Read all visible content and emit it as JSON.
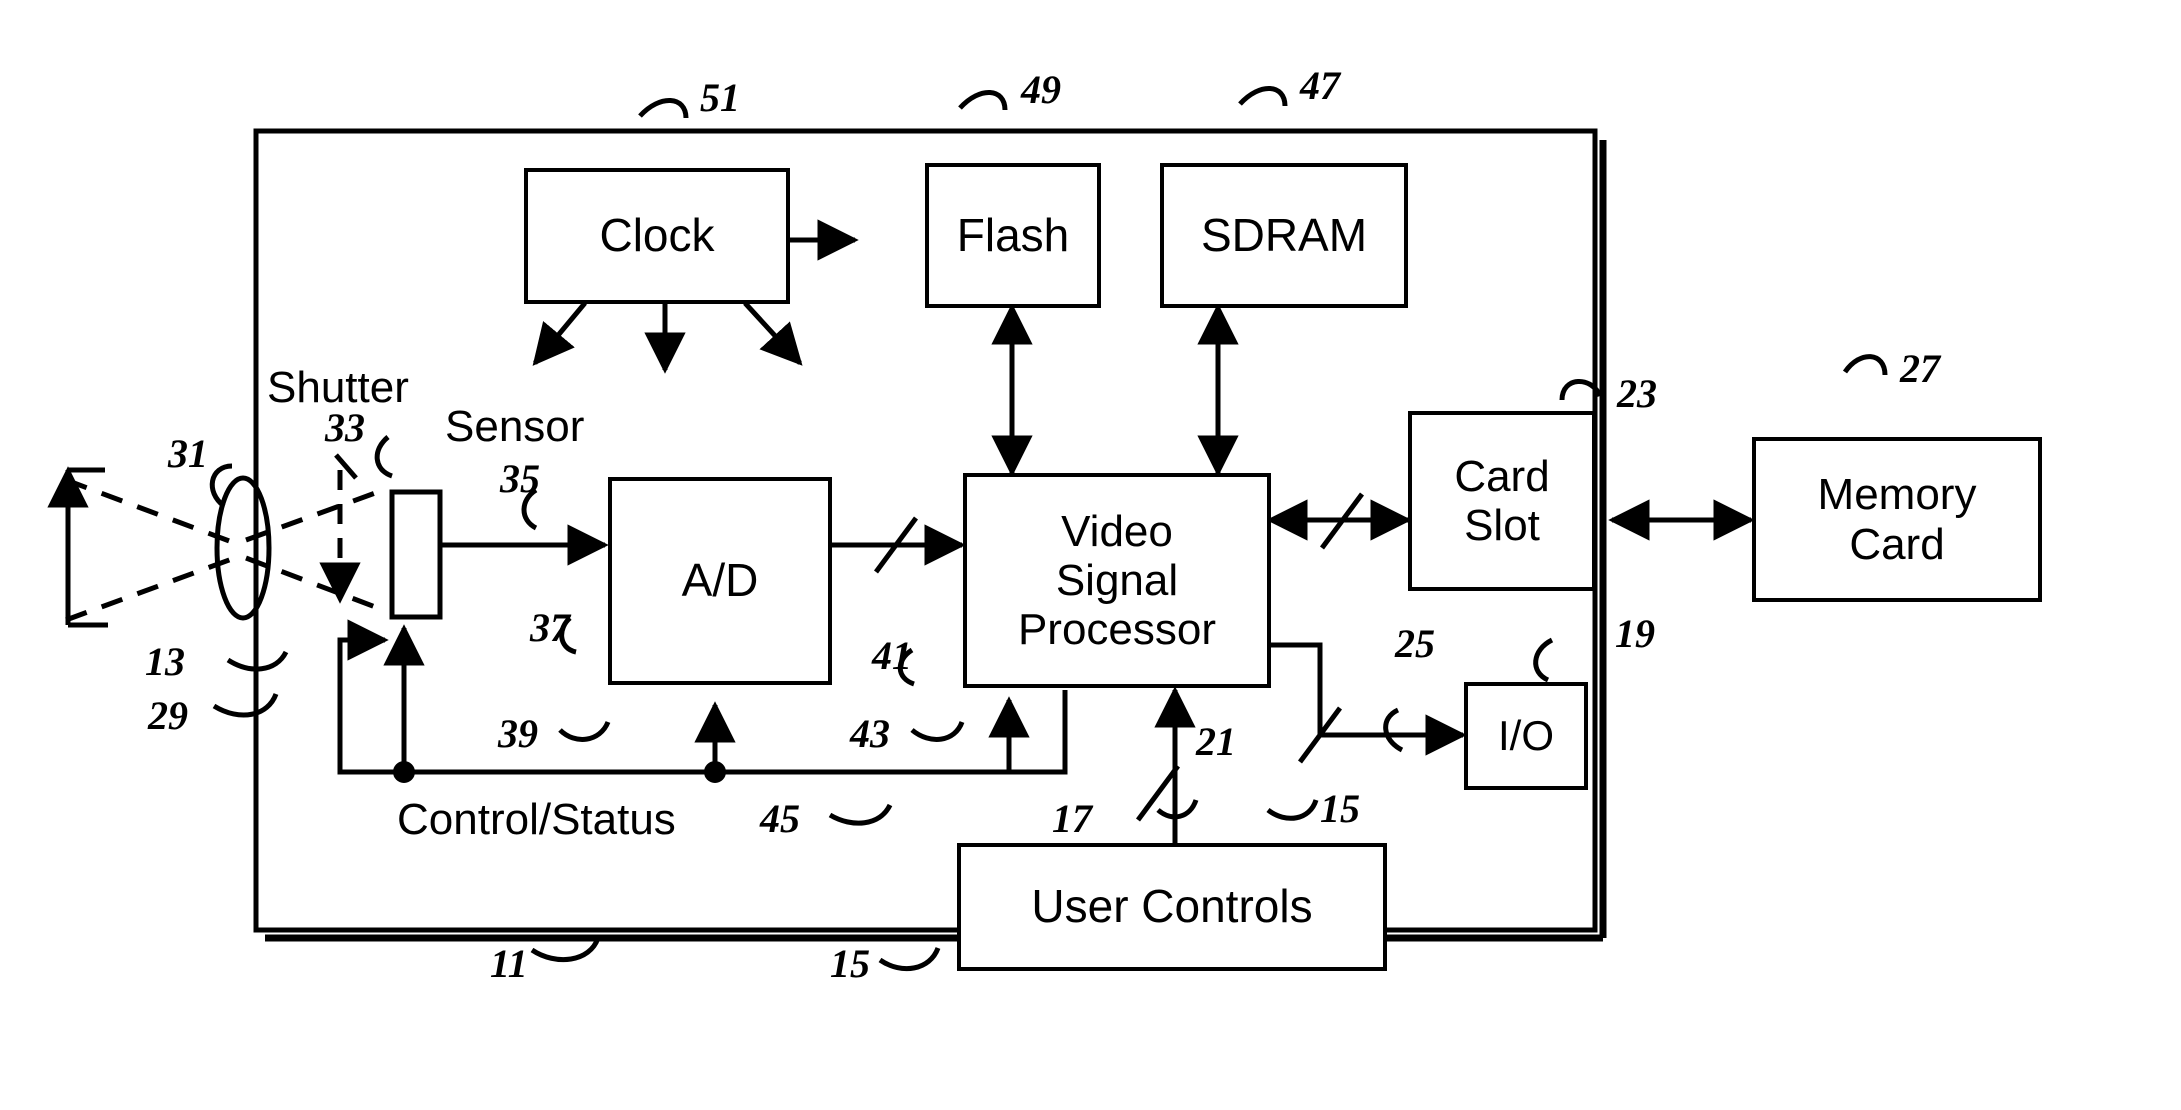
{
  "figure": {
    "type": "block-diagram",
    "title": "Digital camera block diagram",
    "blocks": [
      {
        "id": "clock",
        "label": "Clock"
      },
      {
        "id": "flash",
        "label": "Flash"
      },
      {
        "id": "sdram",
        "label": "SDRAM"
      },
      {
        "id": "ad",
        "label": "A/D"
      },
      {
        "id": "vsp",
        "label": "Video\nSignal\nProcessor"
      },
      {
        "id": "card_slot",
        "label": "Card\nSlot"
      },
      {
        "id": "memory_card",
        "label": "Memory\nCard"
      },
      {
        "id": "io",
        "label": "I/O"
      },
      {
        "id": "user_controls",
        "label": "User Controls"
      }
    ],
    "text_labels": [
      {
        "id": "shutter",
        "label": "Shutter"
      },
      {
        "id": "sensor",
        "label": "Sensor"
      },
      {
        "id": "control_status",
        "label": "Control/Status"
      }
    ],
    "reference_numerals": [
      {
        "id": "ref-51",
        "label": "51"
      },
      {
        "id": "ref-49",
        "label": "49"
      },
      {
        "id": "ref-47",
        "label": "47"
      },
      {
        "id": "ref-23",
        "label": "23"
      },
      {
        "id": "ref-27",
        "label": "27"
      },
      {
        "id": "ref-31",
        "label": "31"
      },
      {
        "id": "ref-33",
        "label": "33"
      },
      {
        "id": "ref-35",
        "label": "35"
      },
      {
        "id": "ref-37",
        "label": "37"
      },
      {
        "id": "ref-39",
        "label": "39"
      },
      {
        "id": "ref-41",
        "label": "41"
      },
      {
        "id": "ref-43",
        "label": "43"
      },
      {
        "id": "ref-45",
        "label": "45"
      },
      {
        "id": "ref-13",
        "label": "13"
      },
      {
        "id": "ref-29",
        "label": "29"
      },
      {
        "id": "ref-25",
        "label": "25"
      },
      {
        "id": "ref-19",
        "label": "19"
      },
      {
        "id": "ref-21",
        "label": "21"
      },
      {
        "id": "ref-17",
        "label": "17"
      },
      {
        "id": "ref-15a",
        "label": "15"
      },
      {
        "id": "ref-15b",
        "label": "15"
      },
      {
        "id": "ref-11",
        "label": "11"
      }
    ],
    "colors": {
      "ink": "#000000",
      "paper": "#ffffff"
    }
  }
}
